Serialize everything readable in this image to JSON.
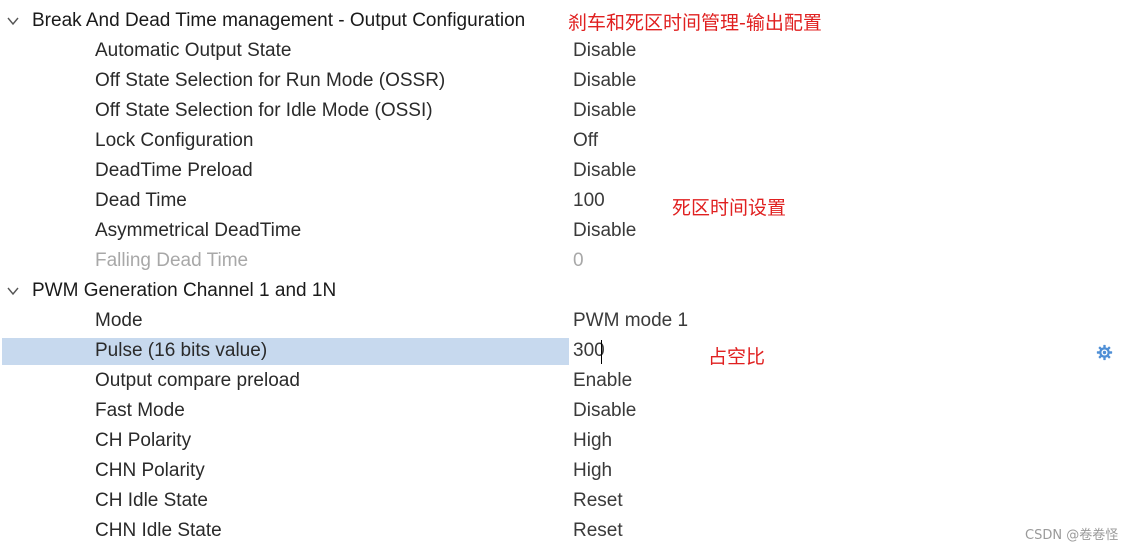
{
  "groups": [
    {
      "title": "Break And Dead Time management - Output Configuration",
      "expanded": true,
      "params": [
        {
          "label": "Automatic Output State",
          "value": "Disable"
        },
        {
          "label": "Off State Selection for Run Mode (OSSR)",
          "value": "Disable"
        },
        {
          "label": "Off State Selection for Idle Mode (OSSI)",
          "value": "Disable"
        },
        {
          "label": "Lock Configuration",
          "value": "Off"
        },
        {
          "label": "DeadTime Preload",
          "value": "Disable"
        },
        {
          "label": "Dead Time",
          "value": "100"
        },
        {
          "label": "Asymmetrical DeadTime",
          "value": "Disable"
        },
        {
          "label": "Falling Dead Time",
          "value": "0",
          "disabled": true
        }
      ]
    },
    {
      "title": "PWM Generation Channel 1 and 1N",
      "expanded": true,
      "params": [
        {
          "label": "Mode",
          "value": "PWM mode 1"
        },
        {
          "label": "Pulse (16 bits value)",
          "value": "300",
          "selected": true,
          "editing": true
        },
        {
          "label": "Output compare preload",
          "value": "Enable"
        },
        {
          "label": "Fast Mode",
          "value": "Disable"
        },
        {
          "label": "CH Polarity",
          "value": "High"
        },
        {
          "label": "CHN Polarity",
          "value": "High"
        },
        {
          "label": "CH Idle State",
          "value": "Reset"
        },
        {
          "label": "CHN Idle State",
          "value": "Reset"
        }
      ]
    }
  ],
  "annotations": {
    "output_config": "刹车和死区时间管理-输出配置",
    "dead_time": "死区时间设置",
    "duty_cycle": "占空比"
  },
  "watermark": "CSDN @卷卷怪",
  "icons": {
    "group_toggle": "chevron-down-icon",
    "settings": "gear-icon"
  },
  "colors": {
    "selection": "#c7d9ee",
    "annotation": "#e02020",
    "disabled_text": "#a8a8a8",
    "gear": "#4f8fd6"
  }
}
